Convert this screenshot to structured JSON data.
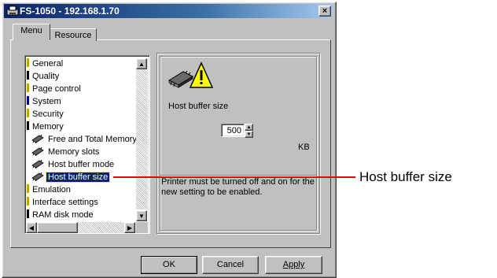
{
  "window": {
    "title": "FS-1050 - 192.168.1.70",
    "close_label": "×"
  },
  "tabs": [
    {
      "label": "Menu",
      "active": true
    },
    {
      "label": "Resource",
      "active": false
    }
  ],
  "tree": {
    "items": [
      {
        "label": "General",
        "icon": "yellow-tick-icon",
        "color": "#c8a000",
        "indent": 0
      },
      {
        "label": "Quality",
        "icon": "black-tick-icon",
        "color": "#000000",
        "indent": 0
      },
      {
        "label": "Page control",
        "icon": "yellow-tick-icon",
        "color": "#c8a000",
        "indent": 0
      },
      {
        "label": "System",
        "icon": "navy-tick-icon",
        "color": "#000080",
        "indent": 0
      },
      {
        "label": "Security",
        "icon": "yellow-tick-icon",
        "color": "#c8a000",
        "indent": 0
      },
      {
        "label": "Memory",
        "icon": "black-tick-icon",
        "color": "#000000",
        "indent": 0
      },
      {
        "label": "Free and Total Memory",
        "icon": "memory-chip-icon",
        "indent": 1
      },
      {
        "label": "Memory slots",
        "icon": "memory-chip-icon",
        "indent": 1
      },
      {
        "label": "Host buffer mode",
        "icon": "memory-chip-icon",
        "indent": 1
      },
      {
        "label": "Host buffer size",
        "icon": "memory-chip-icon",
        "indent": 1,
        "selected": true
      },
      {
        "label": "Emulation",
        "icon": "yellow-tick-icon",
        "color": "#c8a000",
        "indent": 0
      },
      {
        "label": "Interface settings",
        "icon": "yellow-tick-icon",
        "color": "#c8a000",
        "indent": 0
      },
      {
        "label": "RAM disk mode",
        "icon": "black-tick-icon",
        "color": "#000000",
        "indent": 0
      }
    ]
  },
  "scrollbars": {
    "up": "▲",
    "down": "▼",
    "left": "◀",
    "right": "▶"
  },
  "settings": {
    "label": "Host buffer size",
    "value": "500",
    "unit": "KB",
    "spin_up": "▲",
    "spin_down": "▼",
    "notice": "Printer must be turned off and on for the new setting to be enabled."
  },
  "buttons": {
    "ok": "OK",
    "cancel": "Cancel",
    "apply": "Apply"
  },
  "callout": {
    "label": "Host buffer size",
    "color": "#e60000"
  }
}
